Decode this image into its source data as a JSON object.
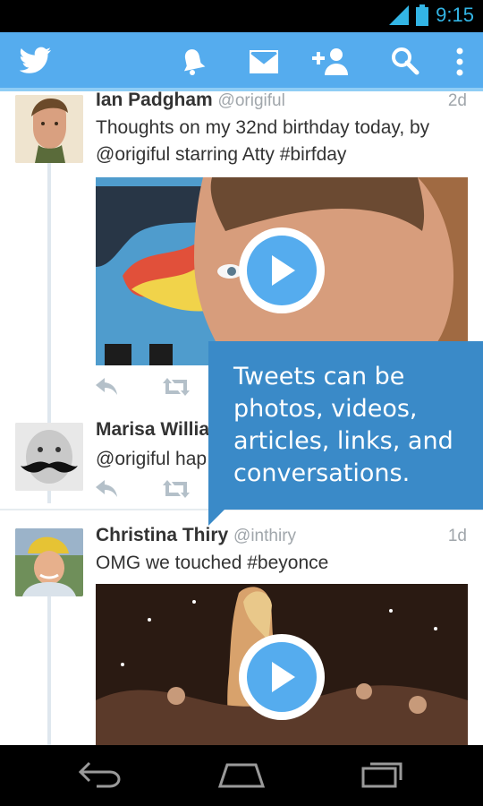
{
  "status_bar": {
    "time": "9:15"
  },
  "app_bar": {
    "icons": [
      "twitter-bird-icon",
      "notifications-icon",
      "messages-icon",
      "add-user-icon",
      "search-icon",
      "overflow-menu-icon"
    ]
  },
  "tweets": [
    {
      "name": "Ian Padgham",
      "handle": "@origiful",
      "time": "2d",
      "text": "Thoughts on my 32nd birthday today, by @origiful starring Atty #birfday",
      "media": "video"
    },
    {
      "name": "Marisa Willia",
      "handle": "",
      "time": "",
      "text": "@origiful hap"
    },
    {
      "name": "Christina Thiry",
      "handle": "@inthiry",
      "time": "1d",
      "text": "OMG we touched #beyonce",
      "media": "video"
    }
  ],
  "tooltip": {
    "text": "Tweets can be photos, videos, articles, links, and conversations."
  },
  "colors": {
    "brand": "#55acee",
    "tooltip": "#3a8ac8"
  }
}
